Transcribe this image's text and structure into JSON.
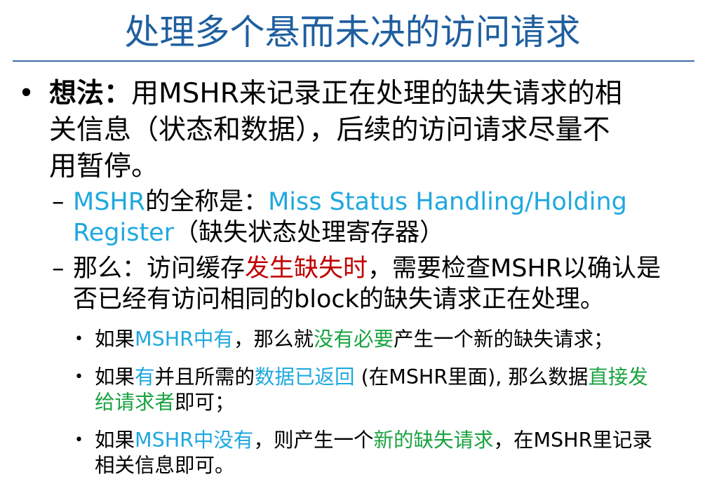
{
  "title": "处理多个悬而未决的访问请求",
  "bullet_main": {
    "label": "想法：",
    "line1": "用MSHR来记录正在处理的缺失请求的相",
    "line2": "关信息（状态和数据），后续的访问请求尽量不",
    "line3": "用暂停。"
  },
  "sub1": {
    "p1": "MSHR",
    "p2": "的全称是：",
    "p3": "Miss Status Handling/Holding",
    "p4": "Register",
    "p5": "（缺失状态处理寄存器）"
  },
  "sub2": {
    "p1": "那么：访问缓存",
    "p2": "发生缺失时",
    "p3": "，需要检查MSHR以确认是",
    "p4": "否已经有访问相同的block的缺失请求正在处理。"
  },
  "item1": {
    "p1": "如果",
    "p2": "MSHR中有",
    "p3": "，那么就",
    "p4": "没有必要",
    "p5": "产生一个新的缺失请求；"
  },
  "item2": {
    "p1": "如果",
    "p2": "有",
    "p3": "并且所需的",
    "p4": "数据已返回",
    "p5": " (在MSHR里面), 那么数据",
    "p6": "直接发",
    "p7": "给请求者",
    "p8": "即可；"
  },
  "item3": {
    "p1": "如果",
    "p2": "MSHR中没有",
    "p3": "，则产生一个",
    "p4": "新的缺失请求",
    "p5": "，在MSHR里记录",
    "p6": "相关信息即可。"
  },
  "colors": {
    "title": "#1f5f9f",
    "cyan": "#20a8df",
    "green": "#1aa341",
    "red": "#c00000"
  }
}
